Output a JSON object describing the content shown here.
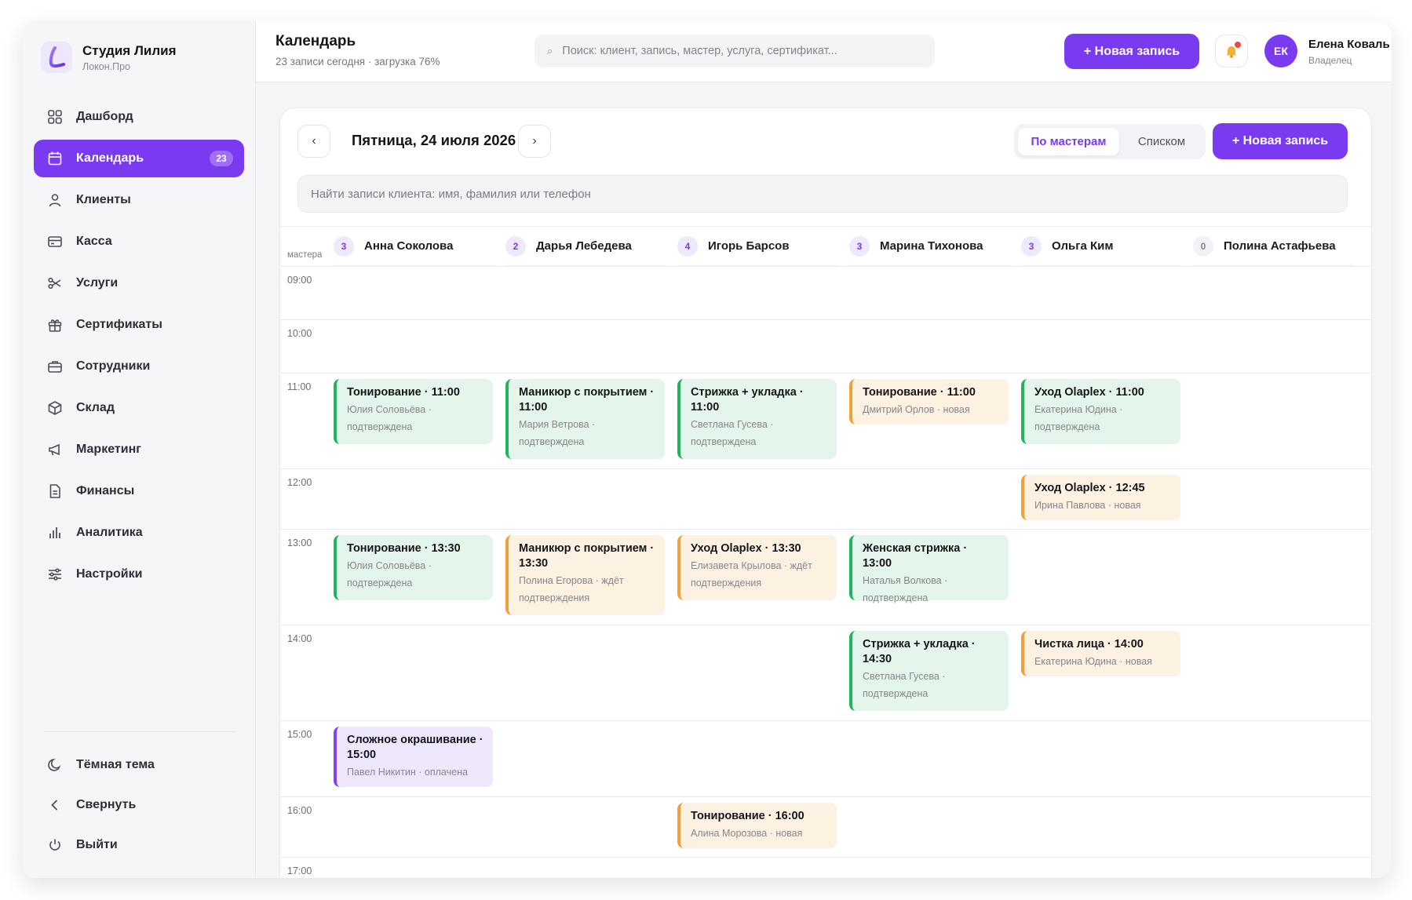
{
  "brand": {
    "name": "Студия Лилия",
    "subtitle": "Локон.Про"
  },
  "sidebar": {
    "items": [
      {
        "label": "Дашборд",
        "icon": "grid-icon"
      },
      {
        "label": "Календарь",
        "icon": "calendar-icon",
        "badge": "23",
        "active": true
      },
      {
        "label": "Клиенты",
        "icon": "user-icon"
      },
      {
        "label": "Касса",
        "icon": "credit-card-icon"
      },
      {
        "label": "Услуги",
        "icon": "scissors-icon"
      },
      {
        "label": "Сертификаты",
        "icon": "gift-icon"
      },
      {
        "label": "Сотрудники",
        "icon": "briefcase-icon"
      },
      {
        "label": "Склад",
        "icon": "box-icon"
      },
      {
        "label": "Маркетинг",
        "icon": "megaphone-icon"
      },
      {
        "label": "Финансы",
        "icon": "document-icon"
      },
      {
        "label": "Аналитика",
        "icon": "bar-chart-icon"
      },
      {
        "label": "Настройки",
        "icon": "sliders-icon"
      }
    ],
    "bottom": [
      {
        "label": "Тёмная тема",
        "icon": "moon-icon"
      },
      {
        "label": "Свернуть",
        "icon": "chevron-left-icon"
      },
      {
        "label": "Выйти",
        "icon": "power-icon"
      }
    ]
  },
  "header": {
    "title": "Календарь",
    "subtitle": "23 записи сегодня · загрузка 76%",
    "search_placeholder": "Поиск: клиент, запись, мастер, услуга, сертификат...",
    "new_button": "+ Новая запись",
    "user": {
      "initials": "ЕК",
      "name": "Елена Коваль",
      "role": "Владелец"
    }
  },
  "calendar": {
    "prev": "‹",
    "next": "›",
    "date": "Пятница, 24 июля 2026",
    "view_masters": "По мастерам",
    "view_list": "Списком",
    "new_button": "+ Новая запись",
    "client_search_placeholder": "Найти записи клиента: имя, фамилия или телефон",
    "masters_label": "мастера",
    "masters": [
      {
        "count": "3",
        "name": "Анна Соколова"
      },
      {
        "count": "2",
        "name": "Дарья Лебедева"
      },
      {
        "count": "4",
        "name": "Игорь Барсов"
      },
      {
        "count": "3",
        "name": "Марина Тихонова"
      },
      {
        "count": "3",
        "name": "Ольга Ким"
      },
      {
        "count": "0",
        "name": "Полина Астафьева"
      }
    ],
    "hours": [
      "09:00",
      "10:00",
      "11:00",
      "12:00",
      "13:00",
      "14:00",
      "15:00",
      "16:00",
      "17:00"
    ],
    "appointments": [
      {
        "master": 0,
        "hour": "11:00",
        "status_color": "green",
        "title": "Тонирование · 11:00",
        "client": "Юлия Соловьёва ·",
        "status": "подтверждена"
      },
      {
        "master": 1,
        "hour": "11:00",
        "status_color": "green",
        "title": "Маникюр с покрытием · 11:00",
        "client": "Мария Ветрова ·",
        "status": "подтверждена"
      },
      {
        "master": 2,
        "hour": "11:00",
        "status_color": "green",
        "title": "Стрижка + укладка · 11:00",
        "client": "Светлана Гусева ·",
        "status": "подтверждена"
      },
      {
        "master": 3,
        "hour": "11:00",
        "status_color": "orange",
        "title": "Тонирование · 11:00",
        "client": "Дмитрий Орлов · новая",
        "status": ""
      },
      {
        "master": 4,
        "hour": "11:00",
        "status_color": "green",
        "title": "Уход Olaplex · 11:00",
        "client": "Екатерина Юдина ·",
        "status": "подтверждена"
      },
      {
        "master": 4,
        "hour": "12:00",
        "status_color": "orange",
        "title": "Уход Olaplex · 12:45",
        "client": "Ирина Павлова · новая",
        "status": ""
      },
      {
        "master": 0,
        "hour": "13:00",
        "status_color": "green",
        "title": "Тонирование · 13:30",
        "client": "Юлия Соловьёва ·",
        "status": "подтверждена"
      },
      {
        "master": 1,
        "hour": "13:00",
        "status_color": "orange",
        "title": "Маникюр с покрытием · 13:30",
        "client": "Полина Егорова · ждёт",
        "status": "подтверждения"
      },
      {
        "master": 2,
        "hour": "13:00",
        "status_color": "orange",
        "title": "Уход Olaplex · 13:30",
        "client": "Елизавета Крылова · ждёт",
        "status": "подтверждения"
      },
      {
        "master": 3,
        "hour": "13:00",
        "status_color": "green",
        "title": "Женская стрижка · 13:00",
        "client": "Наталья Волкова ·",
        "status": "подтверждена"
      },
      {
        "master": 3,
        "hour": "14:00",
        "status_color": "green",
        "title": "Стрижка + укладка · 14:30",
        "client": "Светлана Гусева ·",
        "status": "подтверждена"
      },
      {
        "master": 4,
        "hour": "14:00",
        "status_color": "orange",
        "title": "Чистка лица · 14:00",
        "client": "Екатерина Юдина · новая",
        "status": ""
      },
      {
        "master": 0,
        "hour": "15:00",
        "status_color": "purple",
        "title": "Сложное окрашивание · 15:00",
        "client": "Павел Никитин · оплачена",
        "status": ""
      },
      {
        "master": 2,
        "hour": "16:00",
        "status_color": "orange",
        "title": "Тонирование · 16:00",
        "client": "Алина Морозова · новая",
        "status": ""
      }
    ]
  },
  "colors": {
    "accent": "#7a3af0",
    "confirmed": "#22b35e",
    "new": "#f0a13a",
    "paid": "#8143ec"
  }
}
